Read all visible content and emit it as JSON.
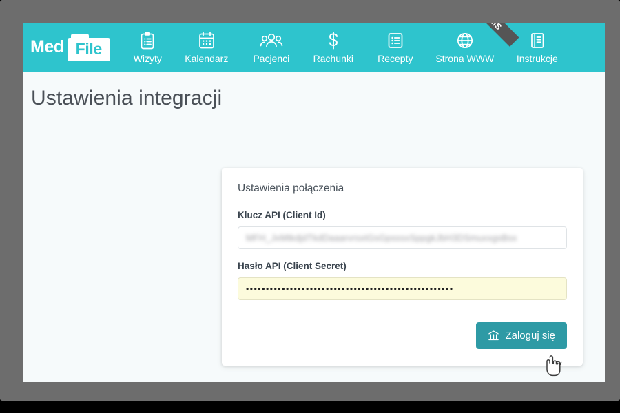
{
  "colors": {
    "frame": "#6d6d6d",
    "nav_teal": "#2ec4cd",
    "button_teal": "#2e9aa5",
    "page_bg": "#f6fafb",
    "autofill_yellow": "#fcfbdc",
    "ribbon_gray": "#555555"
  },
  "nav": {
    "logo": {
      "text_primary": "Med",
      "text_secondary": "File",
      "icon": "folder-icon"
    },
    "items": [
      {
        "label": "Wizyty",
        "icon": "clipboard-icon"
      },
      {
        "label": "Kalendarz",
        "icon": "calendar-icon"
      },
      {
        "label": "Pacjenci",
        "icon": "people-group-icon"
      },
      {
        "label": "Rachunki",
        "icon": "dollar-sign-icon"
      },
      {
        "label": "Recepty",
        "icon": "list-icon"
      },
      {
        "label": "Strona WWW",
        "icon": "globe-icon",
        "badge": "SMS"
      },
      {
        "label": "Instrukcje",
        "icon": "book-icon"
      }
    ]
  },
  "page": {
    "title": "Ustawienia integracji"
  },
  "card": {
    "title": "Ustawienia połączenia",
    "fields": [
      {
        "label": "Klucz API (Client Id)",
        "value": "MFH_JxMtkdjdTkdDaaarvrsxtGsGpsssxSppgkJbH3DSmuxxgsBsx",
        "redacted": true
      },
      {
        "label": "Hasło API (Client Secret)",
        "value": "••••••••••••••••••••••••••••••••••••••••••••••••••••",
        "masked": true
      }
    ],
    "submit": {
      "label": "Zaloguj się",
      "icon": "bank-icon"
    }
  },
  "cursor": {
    "icon": "pointing-hand-cursor"
  }
}
